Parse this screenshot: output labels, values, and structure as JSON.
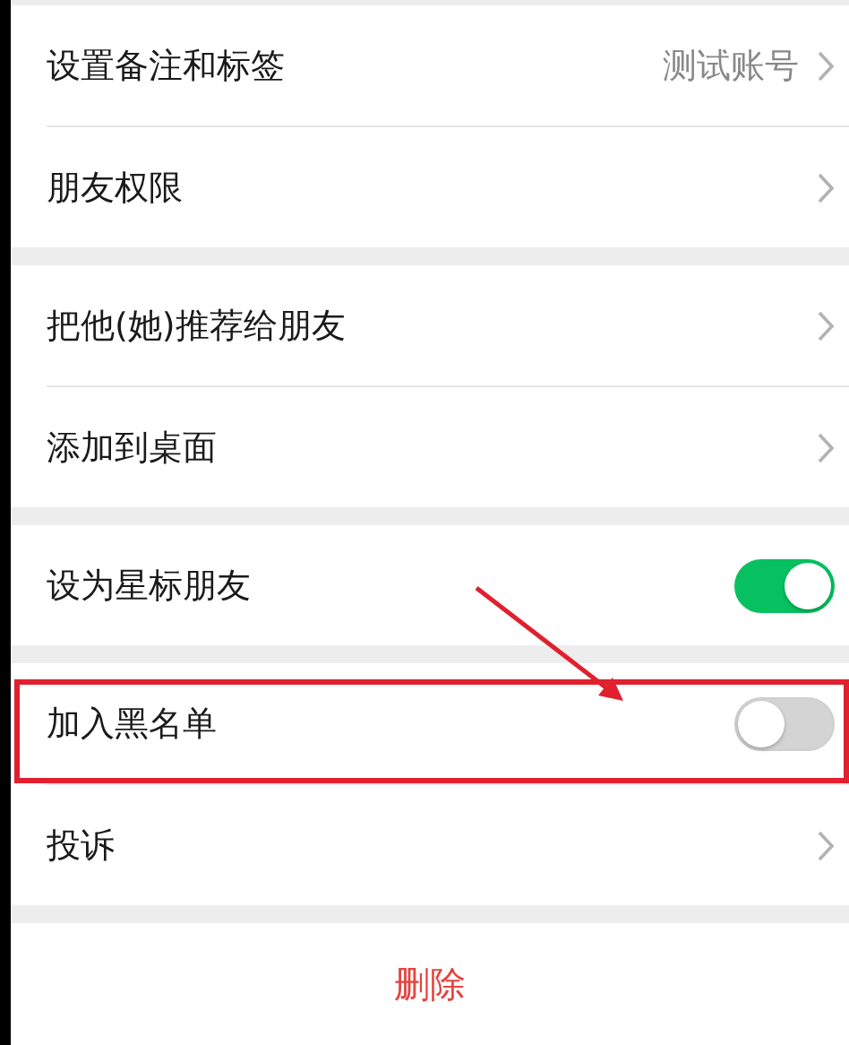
{
  "groups": [
    {
      "items": [
        {
          "kind": "link",
          "label": "设置备注和标签",
          "value": "测试账号"
        },
        {
          "kind": "link",
          "label": "朋友权限"
        }
      ]
    },
    {
      "items": [
        {
          "kind": "link",
          "label": "把他(她)推荐给朋友"
        },
        {
          "kind": "link",
          "label": "添加到桌面"
        }
      ]
    },
    {
      "items": [
        {
          "kind": "switch",
          "label": "设为星标朋友",
          "on": true
        }
      ]
    },
    {
      "items": [
        {
          "kind": "switch",
          "label": "加入黑名单",
          "on": false
        },
        {
          "kind": "link",
          "label": "投诉"
        }
      ]
    }
  ],
  "delete_button": "删除"
}
